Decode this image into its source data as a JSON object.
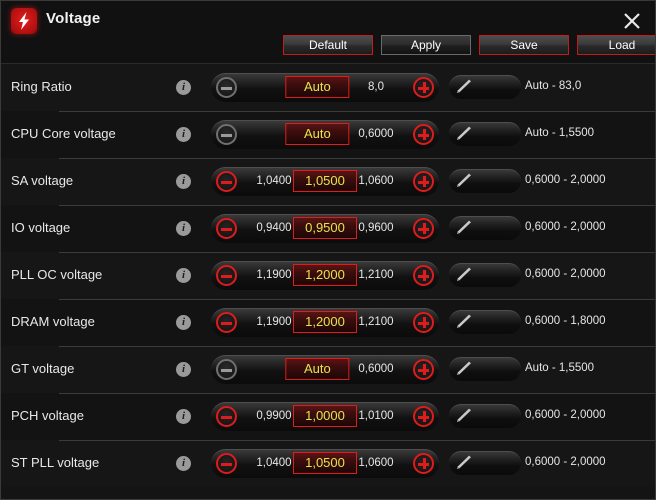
{
  "window": {
    "title": "Voltage",
    "logo_icon": "lightning-bolt-icon",
    "close_icon": "close-icon"
  },
  "header_actions": [
    {
      "label": "Default",
      "style": "accent"
    },
    {
      "label": "Apply",
      "style": "plain"
    },
    {
      "label": "Save",
      "style": "accent"
    },
    {
      "label": "Load",
      "style": "accent"
    }
  ],
  "colors": {
    "accent_red": "#e21b1b",
    "value_yellow": "#e4e44c",
    "window_bg": "#141414",
    "row_bg": "#161616",
    "text": "#e8e8e8"
  },
  "icons": {
    "info": "info-icon",
    "minus": "minus-icon",
    "plus": "plus-icon",
    "pencil": "pencil-icon"
  },
  "rows": [
    {
      "label": "Ring Ratio",
      "mode": "auto",
      "prev_value": "",
      "current_value": "Auto",
      "next_value": "8,0",
      "minus_enabled": false,
      "plus_enabled": true,
      "range": "Auto - 83,0"
    },
    {
      "label": "CPU Core voltage",
      "mode": "auto",
      "prev_value": "",
      "current_value": "Auto",
      "next_value": "0,6000",
      "minus_enabled": false,
      "plus_enabled": true,
      "range": "Auto - 1,5500"
    },
    {
      "label": "SA voltage",
      "mode": "numeric",
      "prev_value": "1,0400",
      "current_value": "1,0500",
      "next_value": "1,0600",
      "minus_enabled": true,
      "plus_enabled": true,
      "range": "0,6000 - 2,0000"
    },
    {
      "label": "IO voltage",
      "mode": "numeric",
      "prev_value": "0,9400",
      "current_value": "0,9500",
      "next_value": "0,9600",
      "minus_enabled": true,
      "plus_enabled": true,
      "range": "0,6000 - 2,0000"
    },
    {
      "label": "PLL OC voltage",
      "mode": "numeric",
      "prev_value": "1,1900",
      "current_value": "1,2000",
      "next_value": "1,2100",
      "minus_enabled": true,
      "plus_enabled": true,
      "range": "0,6000 - 2,0000"
    },
    {
      "label": "DRAM voltage",
      "mode": "numeric",
      "prev_value": "1,1900",
      "current_value": "1,2000",
      "next_value": "1,2100",
      "minus_enabled": true,
      "plus_enabled": true,
      "range": "0,6000 - 1,8000"
    },
    {
      "label": "GT voltage",
      "mode": "auto",
      "prev_value": "",
      "current_value": "Auto",
      "next_value": "0,6000",
      "minus_enabled": false,
      "plus_enabled": true,
      "range": "Auto - 1,5500"
    },
    {
      "label": "PCH voltage",
      "mode": "numeric",
      "prev_value": "0,9900",
      "current_value": "1,0000",
      "next_value": "1,0100",
      "minus_enabled": true,
      "plus_enabled": true,
      "range": "0,6000 - 2,0000"
    },
    {
      "label": "ST PLL voltage",
      "mode": "numeric",
      "prev_value": "1,0400",
      "current_value": "1,0500",
      "next_value": "1,0600",
      "minus_enabled": true,
      "plus_enabled": true,
      "range": "0,6000 - 2,0000"
    }
  ]
}
